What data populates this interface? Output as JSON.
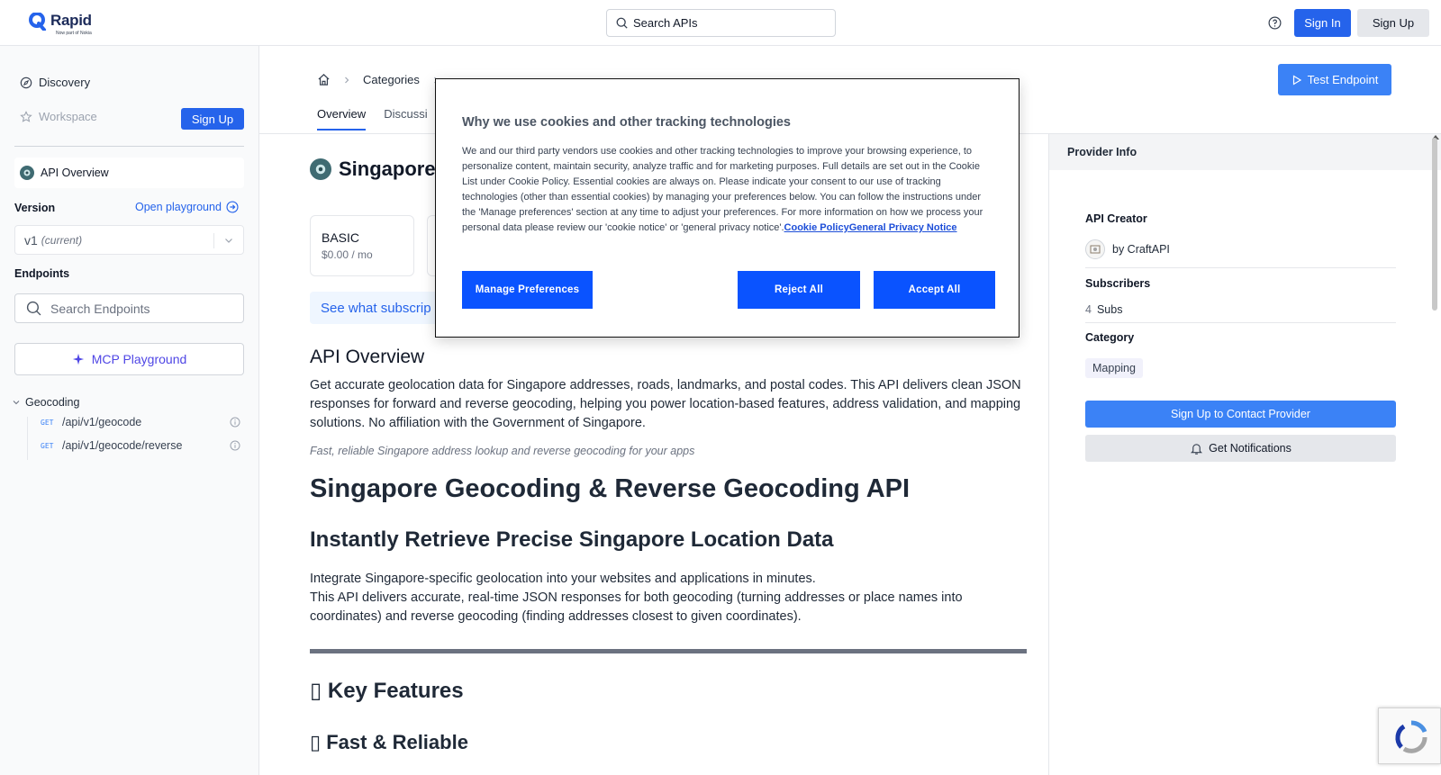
{
  "header": {
    "logo_text": "Rapid",
    "logo_sub": "Now part of Nokia",
    "search_placeholder": "Search APIs",
    "sign_in": "Sign In",
    "sign_up": "Sign Up"
  },
  "sidebar": {
    "discovery": "Discovery",
    "workspace": "Workspace",
    "sign_up": "Sign Up",
    "api_overview": "API Overview",
    "version_label": "Version",
    "open_playground": "Open playground",
    "version_value": "v1",
    "version_note": "(current)",
    "endpoints_label": "Endpoints",
    "search_endpoints": "Search Endpoints",
    "mcp_playground": "MCP Playground",
    "group": "Geocoding",
    "endpoints": [
      {
        "method": "GET",
        "path": "/api/v1/geocode"
      },
      {
        "method": "GET",
        "path": "/api/v1/geocode/reverse"
      }
    ]
  },
  "breadcrumb": {
    "categories": "Categories"
  },
  "tabs": [
    "Overview",
    "Discussi"
  ],
  "test_endpoint": "Test Endpoint",
  "main": {
    "api_name_visible": "Singapore",
    "plans": [
      {
        "name": "BASIC",
        "price": "$0.00 / mo"
      }
    ],
    "see_subscriptions": "See what subscrip",
    "overview_heading": "API Overview",
    "overview_text": "Get accurate geolocation data for Singapore addresses, roads, landmarks, and postal codes. This API delivers clean JSON responses for forward and reverse geocoding, helping you power location-based features, address validation, and mapping solutions. No affiliation with the Government of Singapore.",
    "tagline": "Fast, reliable Singapore address lookup and reverse geocoding for your apps",
    "h1": "Singapore Geocoding & Reverse Geocoding API",
    "h2": "Instantly Retrieve Precise Singapore Location Data",
    "integrate_line1": "Integrate Singapore-specific geolocation into your websites and applications in minutes.",
    "integrate_line2": "This API delivers accurate, real-time JSON responses for both geocoding (turning addresses or place names into coordinates) and reverse geocoding (finding addresses closest to given coordinates).",
    "h3": "▯ Key Features",
    "h4": "▯ Fast & Reliable"
  },
  "provider": {
    "title": "Provider Info",
    "creator_label": "API Creator",
    "creator_name": "by CraftAPI",
    "subscribers_label": "Subscribers",
    "subscribers_count": "4",
    "subscribers_unit": "Subs",
    "category_label": "Category",
    "category_value": "Mapping",
    "contact_button": "Sign Up to Contact Provider",
    "notify_button": "Get Notifications"
  },
  "cookie": {
    "title": "Why we use cookies and other tracking technologies",
    "body": "We and our third party vendors use cookies and other tracking technologies to improve your browsing experience, to personalize content, maintain security, analyze traffic and for marketing purposes. Full details are set out in the Cookie List under Cookie Policy. Essential cookies are always on. Please indicate your consent to our use of tracking technologies (other than essential cookies) by managing your preferences below. You can follow the instructions under the 'Manage preferences' section at any time to adjust your preferences. For more information on how we process your personal data please review our 'cookie notice' or 'general privacy notice'.",
    "link_policy": "Cookie Policy",
    "link_privacy": "General Privacy Notice",
    "manage": "Manage Preferences",
    "reject": "Reject All",
    "accept": "Accept All"
  },
  "colors": {
    "primary": "#2563eb",
    "cookie_button": "#0a53ff",
    "mcp": "#4f46e5"
  }
}
